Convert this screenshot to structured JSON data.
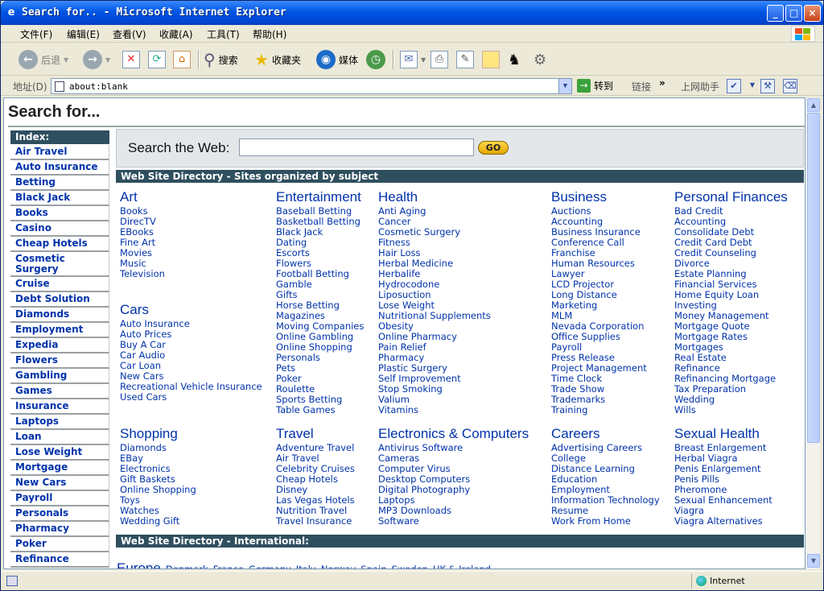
{
  "window": {
    "title": "Search for.. - Microsoft Internet Explorer",
    "min": "_",
    "max": "□",
    "close": "×"
  },
  "menu": [
    "文件(F)",
    "编辑(E)",
    "查看(V)",
    "收藏(A)",
    "工具(T)",
    "帮助(H)"
  ],
  "toolbar": {
    "back": "后退",
    "search": "搜索",
    "favorites": "收藏夹",
    "media": "媒体"
  },
  "address": {
    "label": "地址(D)",
    "value": "about:blank",
    "go": "转到",
    "links": "链接",
    "helper": "上网助手"
  },
  "status": {
    "zone": "Internet"
  },
  "page": {
    "title": "Search for...",
    "index_label": "Index:",
    "index": [
      "Air Travel",
      "Auto Insurance",
      "Betting",
      "Black Jack",
      "Books",
      "Casino",
      "Cheap Hotels",
      "Cosmetic Surgery",
      "Cruise",
      "Debt Solution",
      "Diamonds",
      "Employment",
      "Expedia",
      "Flowers",
      "Gambling",
      "Games",
      "Insurance",
      "Laptops",
      "Loan",
      "Lose Weight",
      "Mortgage",
      "New Cars",
      "Payroll",
      "Personals",
      "Pharmacy",
      "Poker",
      "Refinance"
    ],
    "search_label": "Search the Web:",
    "search_go": "GO",
    "directory_header": "Web Site Directory - Sites organized by subject",
    "international_header": "Web Site Directory - International:",
    "categories": [
      {
        "title": "Art",
        "links": [
          "Books",
          "DirecTV",
          "EBooks",
          "Fine Art",
          "Movies",
          "Music",
          "Television"
        ]
      },
      {
        "title": "Cars",
        "links": [
          "Auto Insurance",
          "Auto Prices",
          "Buy A Car",
          "Car Audio",
          "Car Loan",
          "New Cars",
          "Recreational Vehicle Insurance",
          "Used Cars"
        ]
      },
      {
        "title": "Shopping",
        "links": [
          "Diamonds",
          "EBay",
          "Electronics",
          "Gift Baskets",
          "Online Shopping",
          "Toys",
          "Watches",
          "Wedding Gift"
        ]
      },
      {
        "title": "Entertainment",
        "links": [
          "Baseball Betting",
          "Basketball Betting",
          "Black Jack",
          "Dating",
          "Escorts",
          "Flowers",
          "Football Betting",
          "Gamble",
          "Gifts",
          "Horse Betting",
          "Magazines",
          "Moving Companies",
          "Online Gambling",
          "Online Shopping",
          "Personals",
          "Pets",
          "Poker",
          "Roulette",
          "Sports Betting",
          "Table Games"
        ]
      },
      {
        "title": "Travel",
        "links": [
          "Adventure Travel",
          "Air Travel",
          "Celebrity Cruises",
          "Cheap Hotels",
          "Disney",
          "Las Vegas Hotels",
          "Nutrition Travel",
          "Travel Insurance"
        ]
      },
      {
        "title": "Health",
        "links": [
          "Anti Aging",
          "Cancer",
          "Cosmetic Surgery",
          "Fitness",
          "Hair Loss",
          "Herbal Medicine",
          "Herbalife",
          "Hydrocodone",
          "Liposuction",
          "Lose Weight",
          "Nutritional Supplements",
          "Obesity",
          "Online Pharmacy",
          "Pain Relief",
          "Pharmacy",
          "Plastic Surgery",
          "Self Improvement",
          "Stop Smoking",
          "Valium",
          "Vitamins"
        ]
      },
      {
        "title": "Electronics & Computers",
        "links": [
          "Antivirus Software",
          "Cameras",
          "Computer Virus",
          "Desktop Computers",
          "Digital Photography",
          "Laptops",
          "MP3 Downloads",
          "Software"
        ]
      },
      {
        "title": "Business",
        "links": [
          "Auctions",
          "Accounting",
          "Business Insurance",
          "Conference Call",
          "Franchise",
          "Human Resources",
          "Lawyer",
          "LCD Projector",
          "Long Distance",
          "Marketing",
          "MLM",
          "Nevada Corporation",
          "Office Supplies",
          "Payroll",
          "Press Release",
          "Project Management",
          "Time Clock",
          "Trade Show",
          "Trademarks",
          "Training"
        ]
      },
      {
        "title": "Careers",
        "links": [
          "Advertising Careers",
          "College",
          "Distance Learning",
          "Education",
          "Employment",
          "Information Technology",
          "Resume",
          "Work From Home"
        ]
      },
      {
        "title": "Personal Finances",
        "links": [
          "Bad Credit",
          "Accounting",
          "Consolidate Debt",
          "Credit Card Debt",
          "Credit Counseling",
          "Divorce",
          "Estate Planning",
          "Financial Services",
          "Home Equity Loan",
          "Investing",
          "Money Management",
          "Mortgage Quote",
          "Mortgage Rates",
          "Mortgages",
          "Real Estate",
          "Refinance",
          "Refinancing Mortgage",
          "Tax Preparation",
          "Wedding",
          "Wills"
        ]
      },
      {
        "title": "Sexual Health",
        "links": [
          "Breast Enlargement",
          "Herbal Viagra",
          "Penis Enlargement",
          "Penis Pills",
          "Pheromone",
          "Sexual Enhancement",
          "Viagra",
          "Viagra Alternatives"
        ]
      }
    ],
    "europe": {
      "title": "Europe",
      "links": [
        "Denmark",
        "France",
        "Germany",
        "Italy",
        "Norway",
        "Spain",
        "Sweden",
        "UK & Ireland"
      ]
    }
  }
}
